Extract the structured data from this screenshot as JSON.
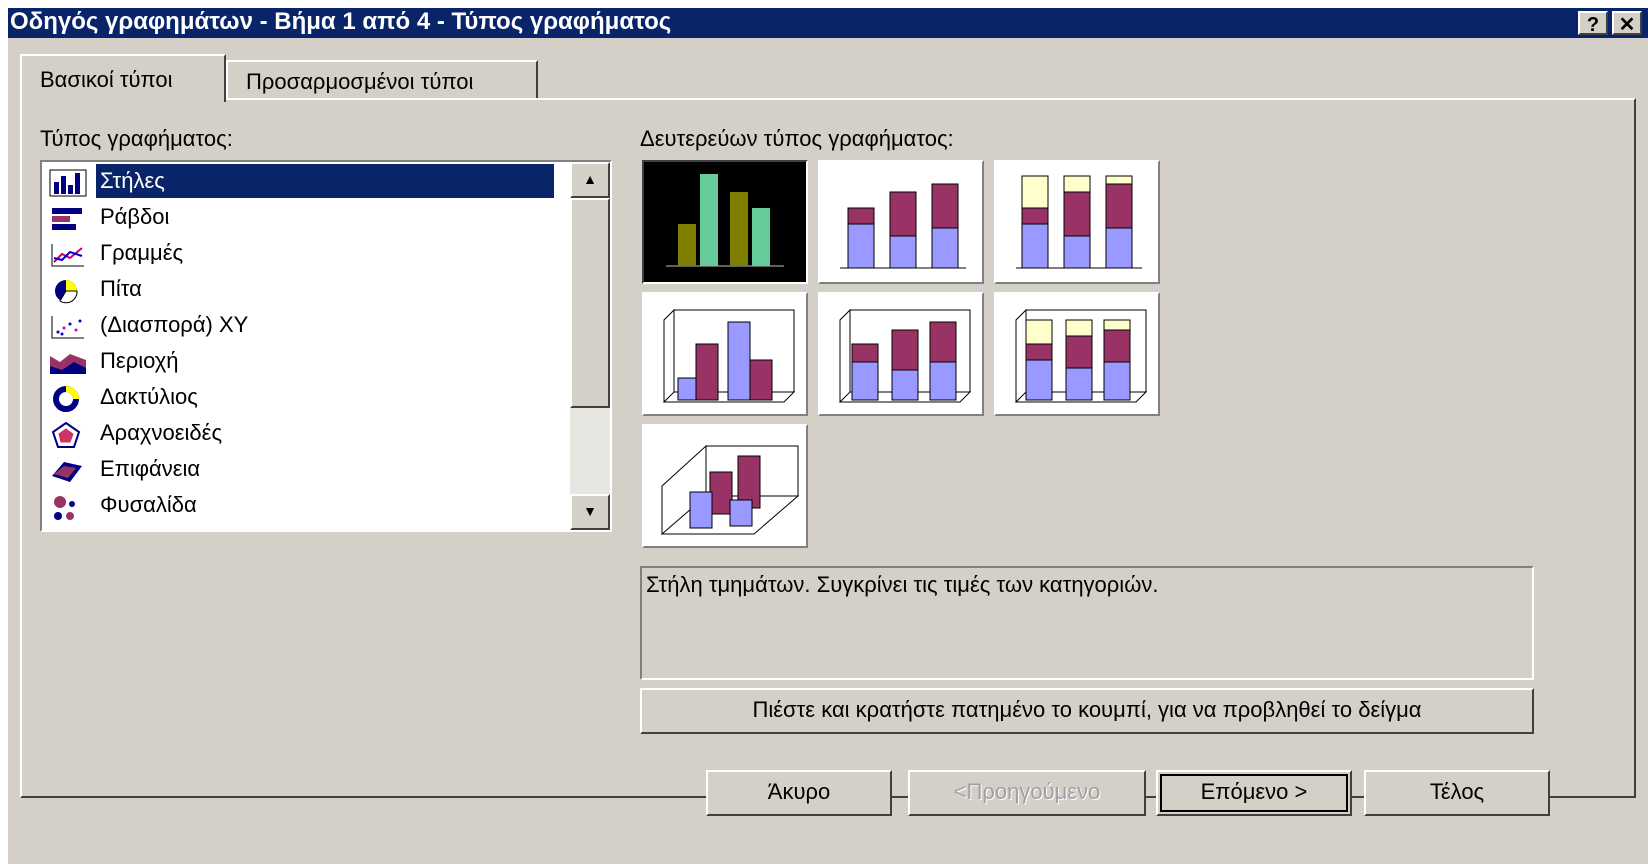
{
  "window": {
    "title": "Οδηγός γραφημάτων - Βήμα 1 από 4 - Τύπος γραφήματος",
    "help_btn": "?",
    "close_btn": "✕"
  },
  "tabs": [
    {
      "label": "Βασικοί τύποι",
      "active": true
    },
    {
      "label": "Προσαρμοσμένοι τύποι",
      "active": false
    }
  ],
  "chart_type": {
    "label": "Τύπος γραφήματος:",
    "items": [
      {
        "label": "Στήλες",
        "icon": "column-chart-icon",
        "selected": true
      },
      {
        "label": "Ράβδοι",
        "icon": "bar-chart-icon"
      },
      {
        "label": "Γραμμές",
        "icon": "line-chart-icon"
      },
      {
        "label": "Πίτα",
        "icon": "pie-chart-icon"
      },
      {
        "label": "(Διασπορά) XY",
        "icon": "scatter-chart-icon"
      },
      {
        "label": "Περιοχή",
        "icon": "area-chart-icon"
      },
      {
        "label": "Δακτύλιος",
        "icon": "doughnut-chart-icon"
      },
      {
        "label": "Αραχνοειδές",
        "icon": "radar-chart-icon"
      },
      {
        "label": "Επιφάνεια",
        "icon": "surface-chart-icon"
      },
      {
        "label": "Φυσαλίδα",
        "icon": "bubble-chart-icon"
      }
    ]
  },
  "subtype": {
    "label": "Δευτερεύων τύπος γραφήματος:",
    "description": "Στήλη τμημάτων. Συγκρίνει τις τιμές των κατηγοριών."
  },
  "buttons": {
    "preview": "Πιέστε και κρατήστε πατημένο το κουμπί, για να προβληθεί το δείγμα",
    "cancel": "Άκυρο",
    "back": "<Προηγούμενο",
    "next": "Επόμενο >",
    "finish": "Τέλος"
  },
  "colors": {
    "titlebar": "#0a246a",
    "face": "#d4d0c8",
    "series_blue": "#9999ff",
    "series_maroon": "#993366",
    "series_cream": "#ffffcc",
    "selected_olive": "#808000",
    "selected_mint": "#66cc99"
  }
}
